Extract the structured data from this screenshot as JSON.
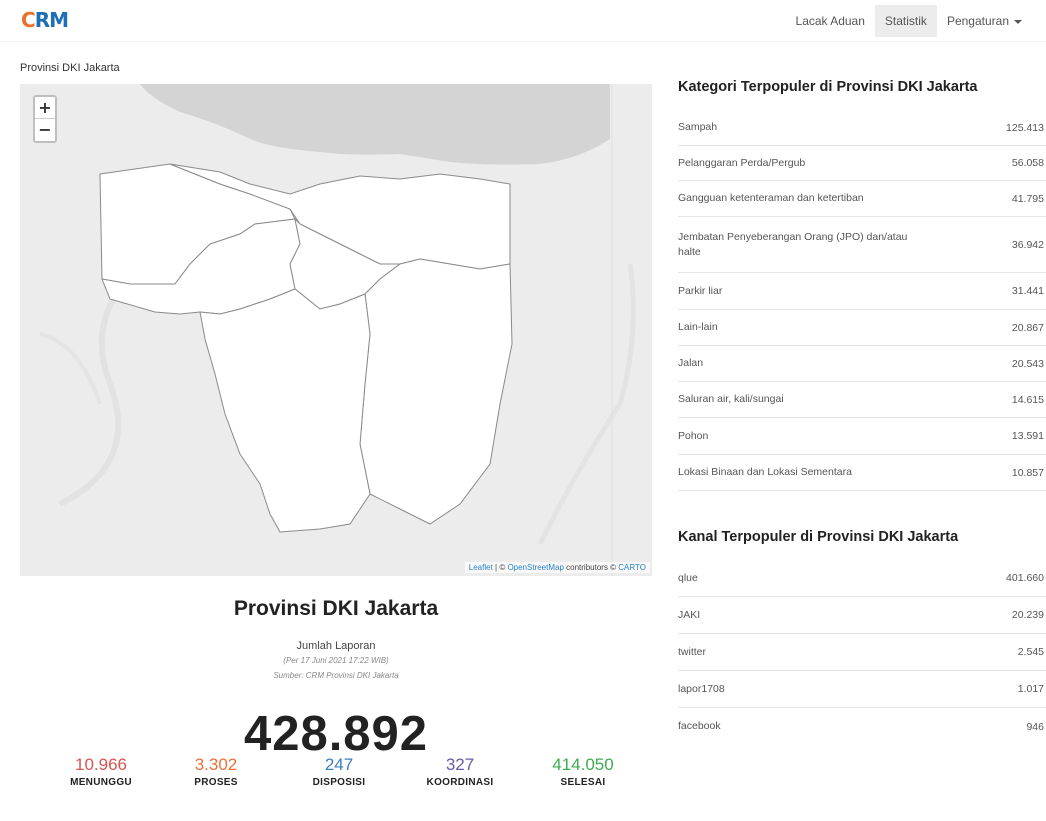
{
  "nav": {
    "logo_c": "C",
    "logo_rm": "RM",
    "items": [
      "Lacak Aduan",
      "Statistik",
      "Pengaturan"
    ]
  },
  "region_label": "Provinsi DKI Jakarta",
  "map": {
    "zoom_in": "+",
    "zoom_out": "−",
    "attribution_leaflet": "Leaflet",
    "attribution_sep1": " | © ",
    "attribution_osm": "OpenStreetMap",
    "attribution_mid": " contributors © ",
    "attribution_carto": "CARTO"
  },
  "summary": {
    "title": "Provinsi DKI Jakarta",
    "jumlah_label": "Jumlah Laporan",
    "per": "(Per 17 Juni 2021 17:22 WIB)",
    "sumber": "Sumber: CRM Provinsi DKI Jakarta",
    "total": "428.892"
  },
  "statuses": [
    {
      "value": "10.966",
      "label": "MENUNGGU",
      "color": "#d9534f"
    },
    {
      "value": "3.302",
      "label": "PROSES",
      "color": "#e8713c"
    },
    {
      "value": "247",
      "label": "DISPOSISI",
      "color": "#3a7fc1"
    },
    {
      "value": "327",
      "label": "KOORDINASI",
      "color": "#6a5aa8"
    },
    {
      "value": "414.050",
      "label": "SELESAI",
      "color": "#3cad4f"
    }
  ],
  "kategori": {
    "title": "Kategori Terpopuler di Provinsi DKI Jakarta",
    "rows": [
      {
        "name": "Sampah",
        "value": "125.413"
      },
      {
        "name": "Pelanggaran Perda/Pergub",
        "value": "56.058"
      },
      {
        "name": "Gangguan ketenteraman dan ketertiban",
        "value": "41.795"
      },
      {
        "name": "Jembatan Penyeberangan Orang (JPO) dan/atau halte",
        "value": "36.942"
      },
      {
        "name": "Parkir liar",
        "value": "31.441"
      },
      {
        "name": "Lain-lain",
        "value": "20.867"
      },
      {
        "name": "Jalan",
        "value": "20.543"
      },
      {
        "name": "Saluran air, kali/sungai",
        "value": "14.615"
      },
      {
        "name": "Pohon",
        "value": "13.591"
      },
      {
        "name": "Lokasi Binaan dan Lokasi Sementara",
        "value": "10.857"
      }
    ]
  },
  "kanal": {
    "title": "Kanal Terpopuler di Provinsi DKI Jakarta",
    "rows": [
      {
        "name": "qlue",
        "value": "401.660"
      },
      {
        "name": "JAKI",
        "value": "20.239"
      },
      {
        "name": "twitter",
        "value": "2.545"
      },
      {
        "name": "lapor1708",
        "value": "1.017"
      },
      {
        "name": "facebook",
        "value": "946"
      }
    ]
  }
}
